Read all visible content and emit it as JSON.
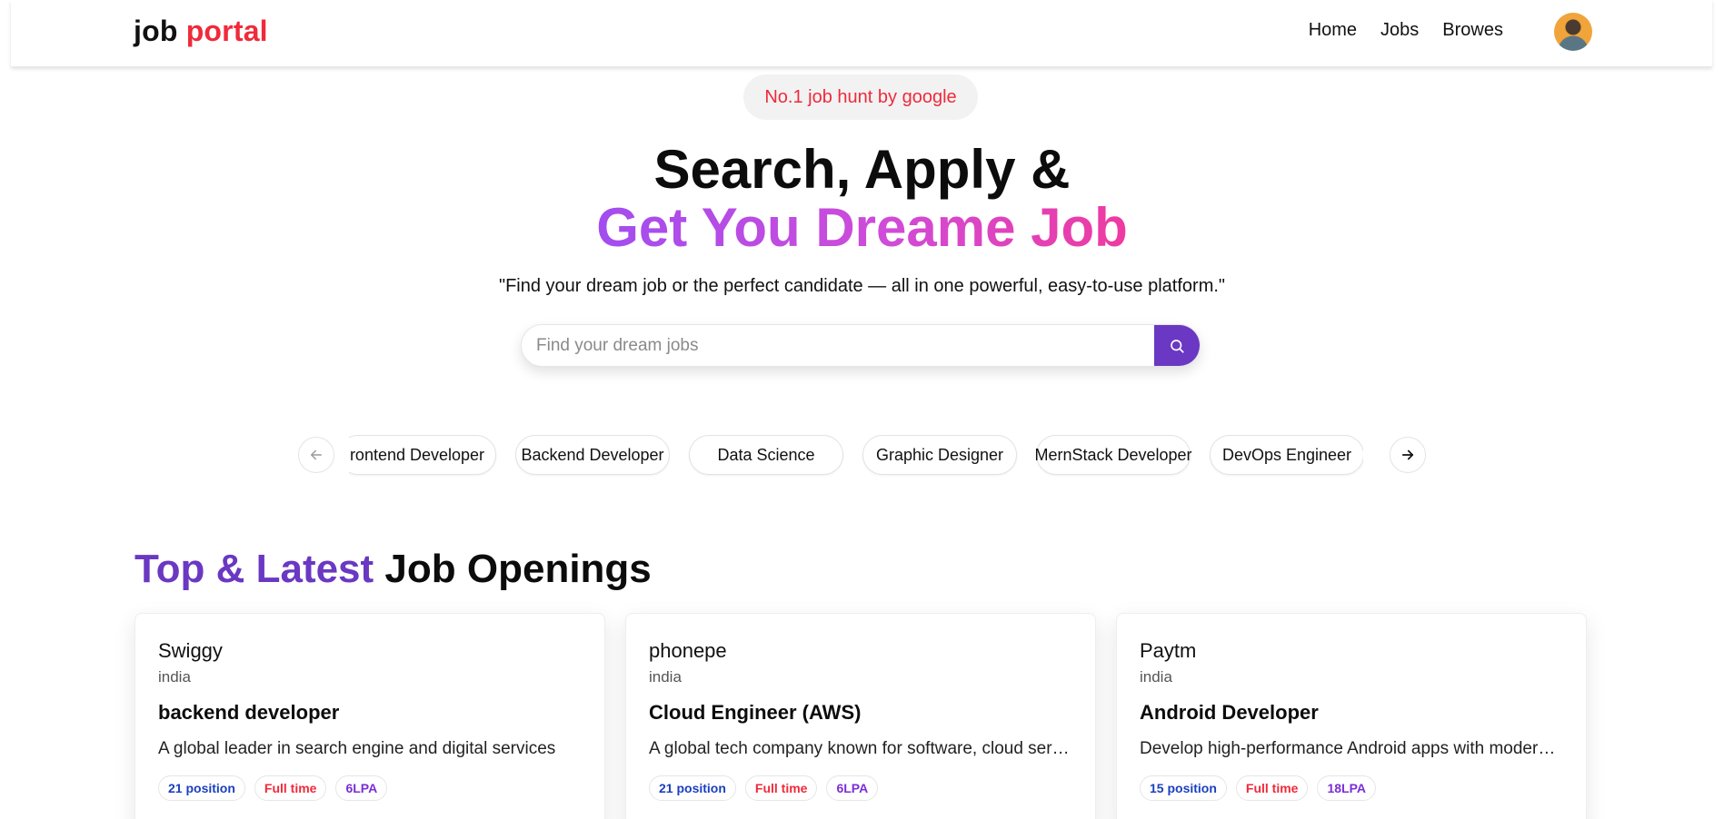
{
  "brand": {
    "part1": "job",
    "part2": "portal"
  },
  "nav": {
    "links": [
      "Home",
      "Jobs",
      "Browes"
    ]
  },
  "hero": {
    "badge": "No.1 job hunt by google",
    "title_line1": "Search, Apply &",
    "title_line2": "Get You Dreame Job",
    "subtitle": "\"Find your dream job or the perfect candidate — all in one powerful, easy-to-use platform.\""
  },
  "search": {
    "placeholder": "Find your dream jobs",
    "value": ""
  },
  "categories": [
    "rontend Developer",
    "Backend Developer",
    "Data Science",
    "Graphic Designer",
    "MernStack Developer",
    "DevOps Engineer"
  ],
  "section": {
    "title_accent": "Top & Latest",
    "title_rest": "Job Openings"
  },
  "jobs": [
    {
      "company": "Swiggy",
      "location": "india",
      "title": "backend developer",
      "description": "A global leader in search engine and digital services",
      "positions": "21 position",
      "type": "Full time",
      "salary": "6LPA"
    },
    {
      "company": "phonepe",
      "location": "india",
      "title": "Cloud Engineer (AWS)",
      "description": "A global tech company known for software, cloud services and more",
      "positions": "21 position",
      "type": "Full time",
      "salary": "6LPA"
    },
    {
      "company": "Paytm",
      "location": "india",
      "title": "Android Developer",
      "description": "Develop high-performance Android apps with modern tools",
      "positions": "15 position",
      "type": "Full time",
      "salary": "18LPA"
    }
  ],
  "colors": {
    "brand_red": "#f02a3a",
    "accent_purple": "#6a38c2"
  }
}
